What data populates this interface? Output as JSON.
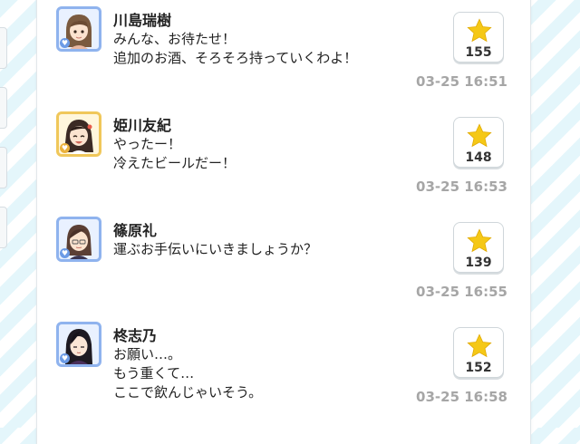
{
  "posts": [
    {
      "author": "川島瑞樹",
      "message": "みんな、お待たせ！\n追加のお酒、そろそろ持っていくわよ！",
      "likes": "155",
      "timestamp": "03-25 16:51",
      "avatar_frame": "#8fb3ee",
      "avatar_icon": "character-portrait-icon"
    },
    {
      "author": "姫川友紀",
      "message": "やったー！\n冷えたビールだー！",
      "likes": "148",
      "timestamp": "03-25 16:53",
      "avatar_frame": "#f0c75a",
      "avatar_icon": "character-portrait-icon"
    },
    {
      "author": "篠原礼",
      "message": "運ぶお手伝いにいきましょうか？",
      "likes": "139",
      "timestamp": "03-25 16:55",
      "avatar_frame": "#8fb3ee",
      "avatar_icon": "character-portrait-icon"
    },
    {
      "author": "柊志乃",
      "message": "お願い…。\nもう重くて…\nここで飲んじゃいそう。",
      "likes": "152",
      "timestamp": "03-25 16:58",
      "avatar_frame": "#8fb3ee",
      "avatar_icon": "character-portrait-icon"
    }
  ],
  "like_icon": "star-icon",
  "colors": {
    "star": "#f5c816",
    "timestamp": "#a6a6a6",
    "stripe": "#e4f6fb"
  }
}
